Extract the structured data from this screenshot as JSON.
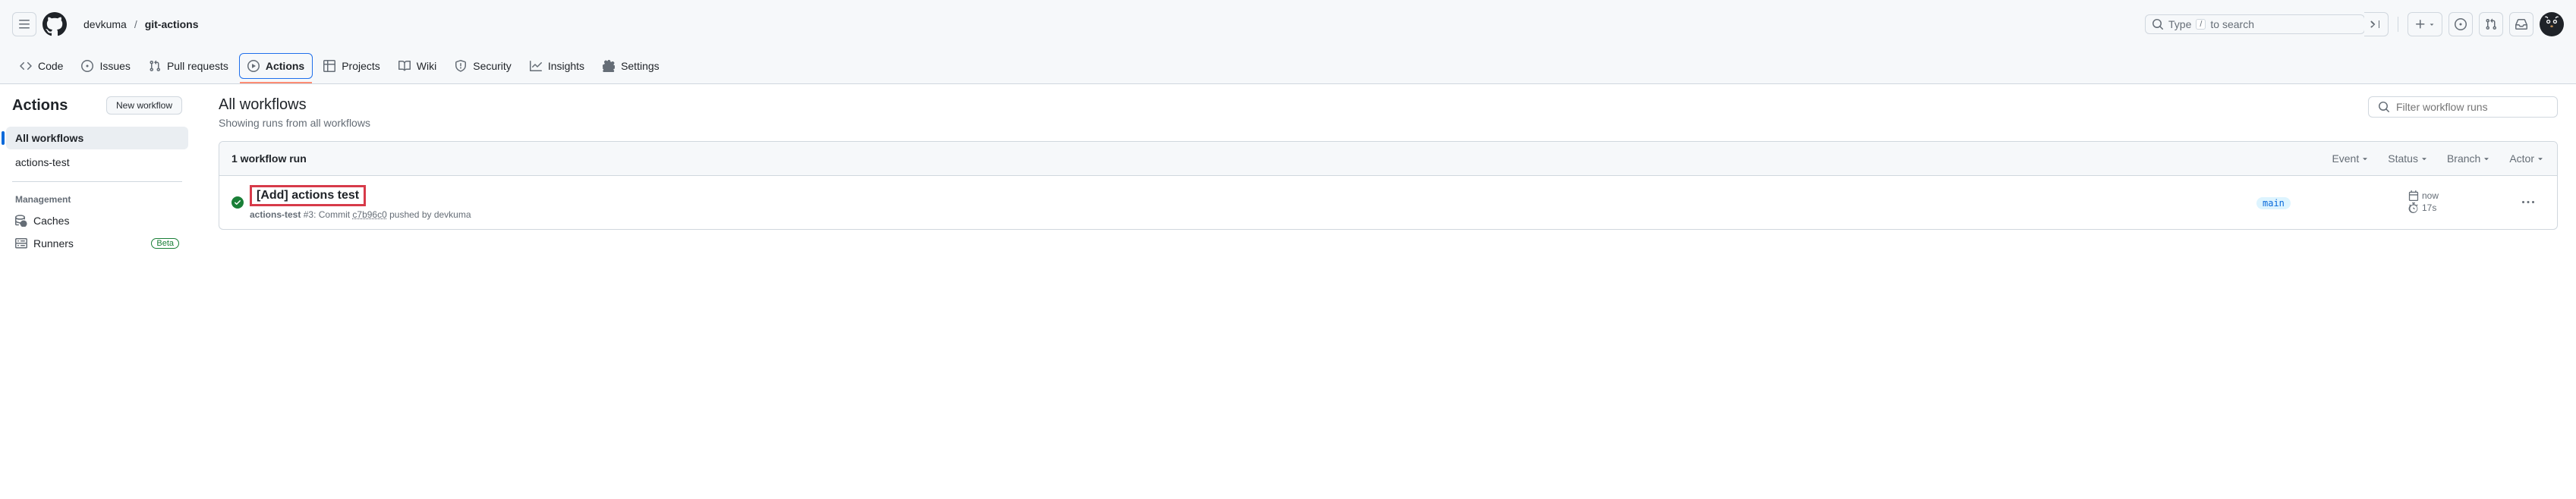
{
  "header": {
    "owner": "devkuma",
    "repo": "git-actions",
    "search_placeholder_pre": "Type",
    "search_kbd": "/",
    "search_placeholder_post": "to search"
  },
  "repo_nav": {
    "code": "Code",
    "issues": "Issues",
    "pull_requests": "Pull requests",
    "actions": "Actions",
    "projects": "Projects",
    "wiki": "Wiki",
    "security": "Security",
    "insights": "Insights",
    "settings": "Settings"
  },
  "sidebar": {
    "title": "Actions",
    "new_workflow": "New workflow",
    "all_workflows": "All workflows",
    "workflows": [
      "actions-test"
    ],
    "management_label": "Management",
    "caches": "Caches",
    "runners": "Runners",
    "beta": "Beta"
  },
  "content": {
    "title": "All workflows",
    "subtitle": "Showing runs from all workflows",
    "filter_placeholder": "Filter workflow runs",
    "runs_count": "1 workflow run",
    "filters": {
      "event": "Event",
      "status": "Status",
      "branch": "Branch",
      "actor": "Actor"
    },
    "run": {
      "title": "[Add] actions test",
      "workflow_name": "actions-test",
      "run_number": "#3",
      "meta_mid": ": Commit ",
      "commit": "c7b96c0",
      "meta_end": " pushed by devkuma",
      "branch": "main",
      "timestamp": "now",
      "duration": "17s"
    }
  }
}
